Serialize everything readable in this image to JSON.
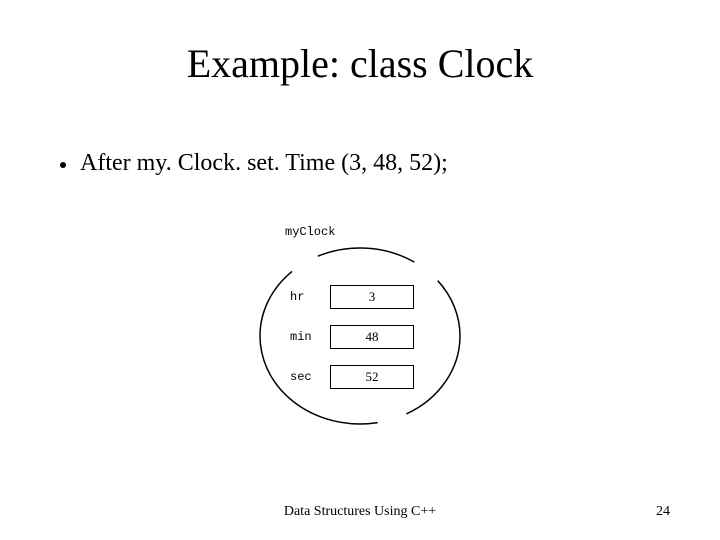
{
  "title": "Example: class Clock",
  "bullet": "After my. Clock. set. Time (3, 48, 52);",
  "diagram": {
    "object_label": "myClock",
    "fields": {
      "hr": {
        "label": "hr",
        "value": "3"
      },
      "min": {
        "label": "min",
        "value": "48"
      },
      "sec": {
        "label": "sec",
        "value": "52"
      }
    }
  },
  "footer": {
    "text": "Data Structures Using C++",
    "page": "24"
  }
}
